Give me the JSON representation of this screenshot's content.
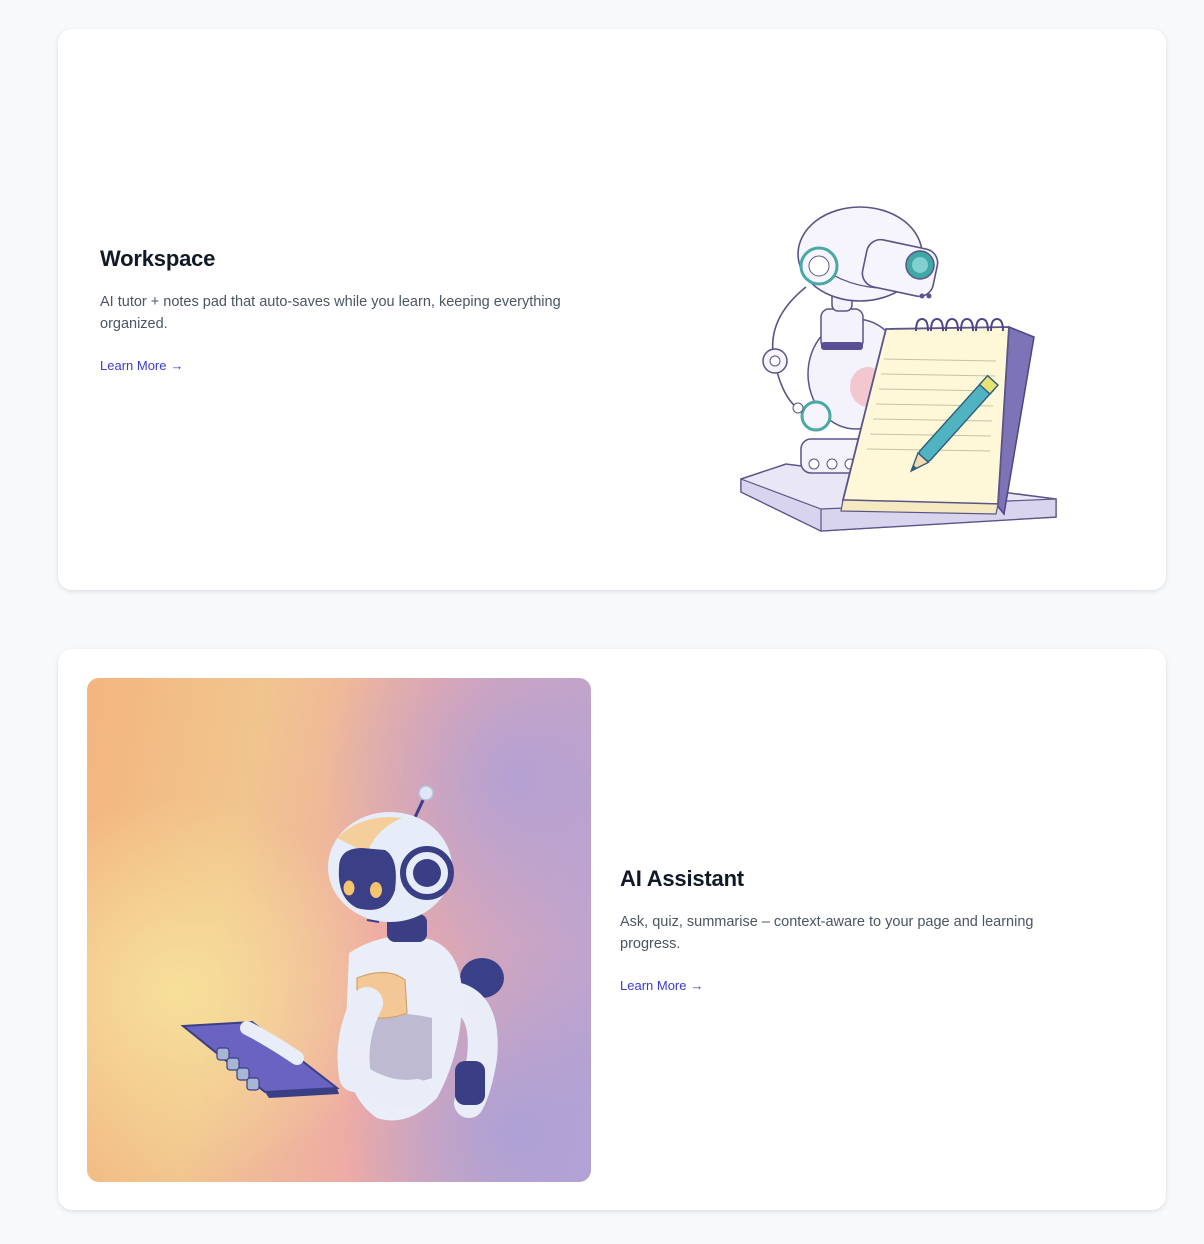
{
  "features": [
    {
      "title": "Workspace",
      "description": "AI tutor + notes pad that auto-saves while you learn, keeping everything organized.",
      "link_label": "Learn More",
      "link_arrow": "→",
      "illustration": "robot-writing-notepad-illustration"
    },
    {
      "title": "AI Assistant",
      "description": "Ask, quiz, summarise – context-aware to your page and learning progress.",
      "link_label": "Learn More",
      "link_arrow": "→",
      "illustration": "robot-holding-tablet-illustration"
    }
  ],
  "colors": {
    "page_bg": "#f7f9fb",
    "card_bg": "#ffffff",
    "title": "#111827",
    "body_text": "#4b5563",
    "link": "#3b3bd0"
  }
}
